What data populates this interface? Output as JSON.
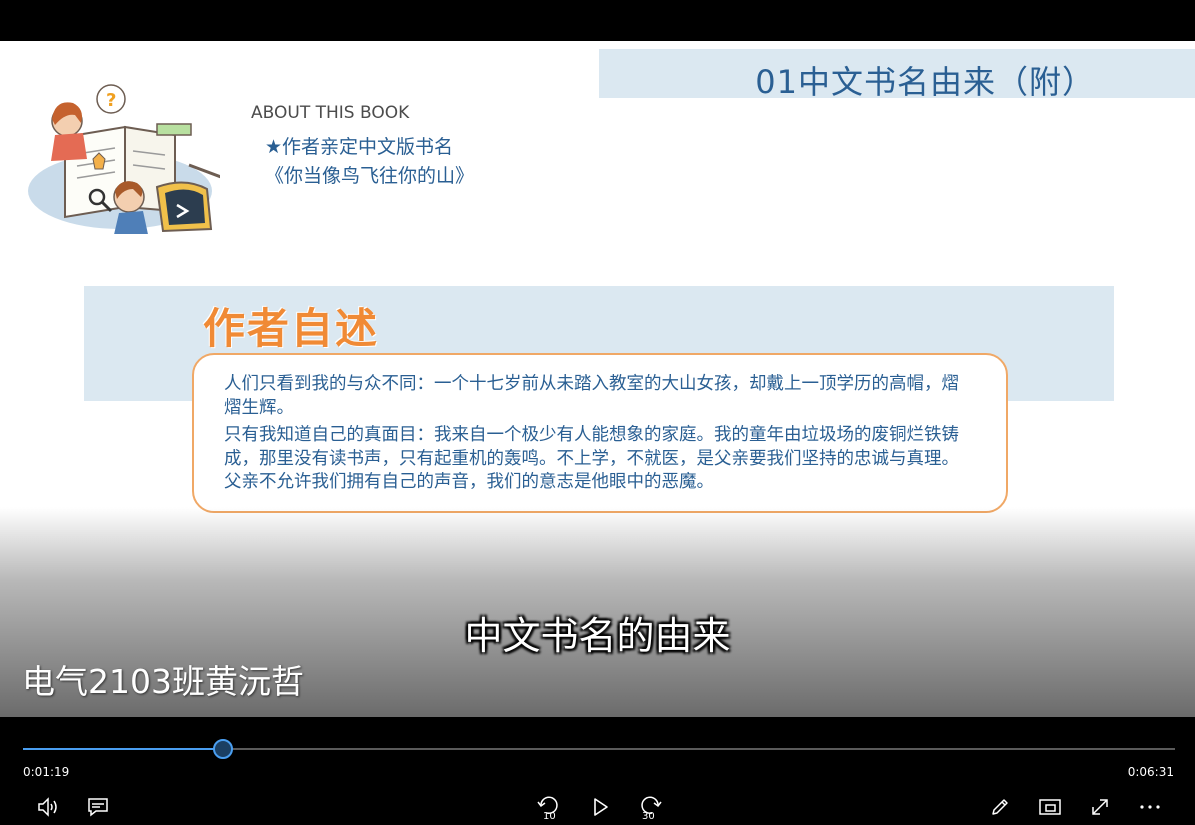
{
  "slide": {
    "title": "01中文书名由来（附）",
    "about_heading": "ABOUT THIS BOOK",
    "about_line1": "★作者亲定中文版书名",
    "about_line2": "《你当像鸟飞往你的山》",
    "section_title": "作者自述",
    "paragraphs": [
      "人们只看到我的与众不同：一个十七岁前从未踏入教室的大山女孩，却戴上一顶学历的高帽，熠熠生辉。",
      "只有我知道自己的真面目：我来自一个极少有人能想象的家庭。我的童年由垃圾场的废铜烂铁铸成，那里没有读书声，只有起重机的轰鸣。不上学，不就医，是父亲要我们坚持的忠诚与真理。父亲不允许我们拥有自己的声音，我们的意志是他眼中的恶魔。"
    ]
  },
  "overlay": {
    "subtitle": "中文书名的由来",
    "watermark": "电气2103班黄沅哲"
  },
  "player": {
    "current_time": "0:01:19",
    "total_time": "0:06:31",
    "progress": 0.174,
    "skip_back_seconds": "10",
    "skip_forward_seconds": "30",
    "accent_color": "#4a9ef0",
    "icons": [
      "volume-icon",
      "captions-icon",
      "skip-back-icon",
      "play-icon",
      "skip-forward-icon",
      "pen-icon",
      "mini-view-icon",
      "fullscreen-icon",
      "more-icon"
    ]
  }
}
